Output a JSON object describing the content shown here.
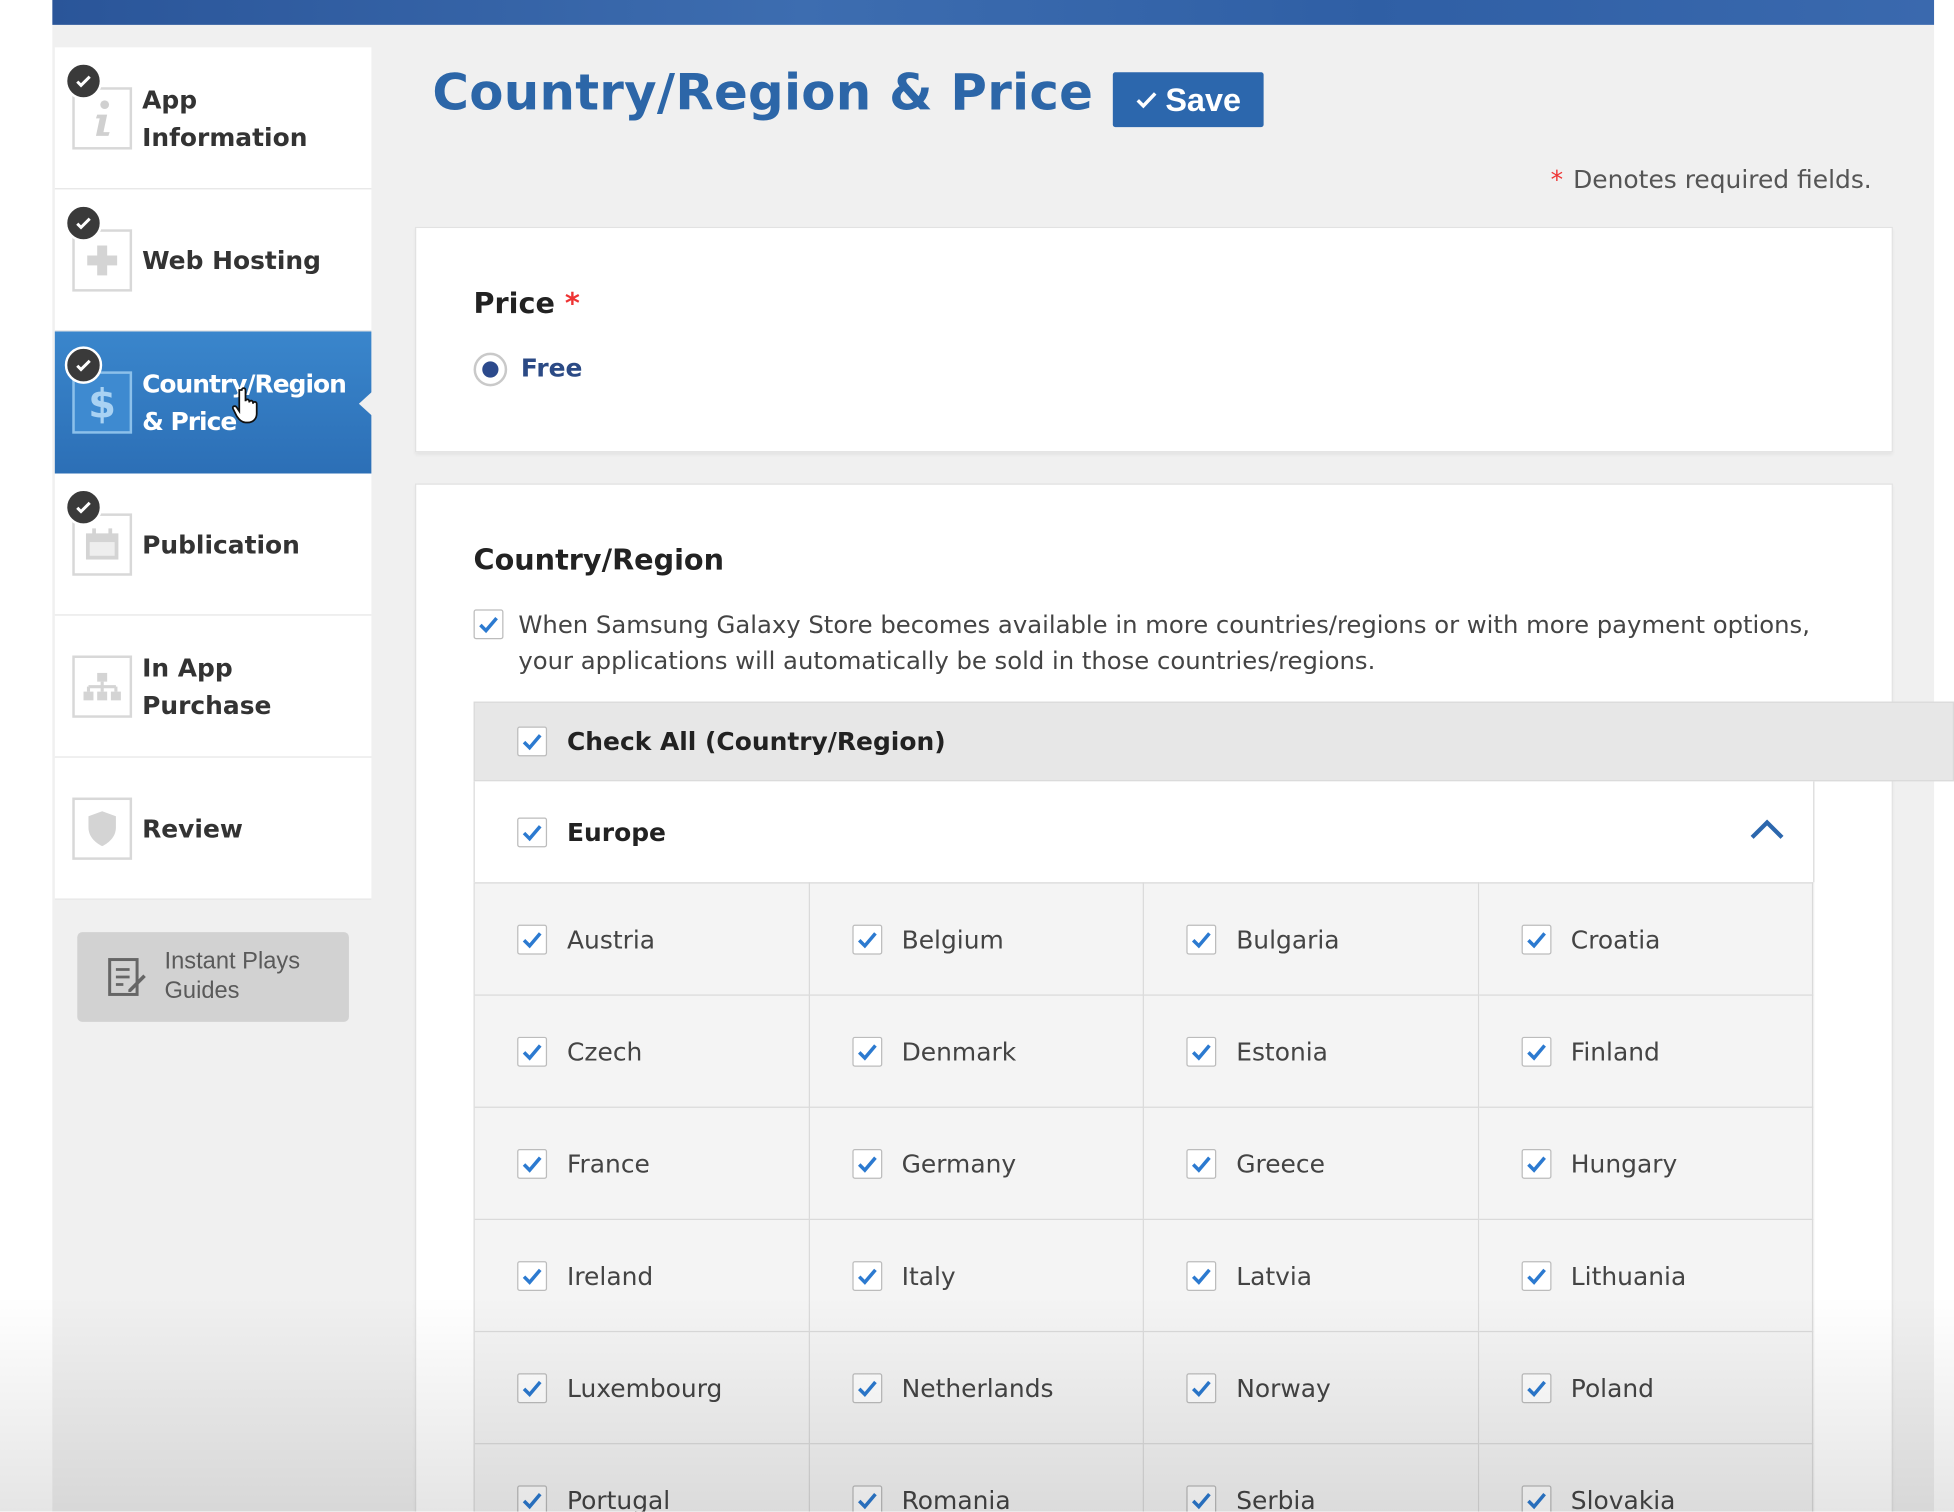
{
  "colors": {
    "brand_blue": "#2c66a8",
    "active_nav": "#2f76bd",
    "checkbox_blue": "#2c7ad0",
    "required_star": "#e33333"
  },
  "sidebar": {
    "items": [
      {
        "label": "App Information",
        "icon": "info-icon",
        "completed": true,
        "active": false
      },
      {
        "label": "Web Hosting",
        "icon": "plus-icon",
        "completed": true,
        "active": false
      },
      {
        "label": "Country/Region & Price",
        "icon": "dollar-icon",
        "completed": true,
        "active": true
      },
      {
        "label": "Publication",
        "icon": "calendar-icon",
        "completed": true,
        "active": false
      },
      {
        "label": "In App Purchase",
        "icon": "hierarchy-icon",
        "completed": false,
        "active": false
      },
      {
        "label": "Review",
        "icon": "shield-icon",
        "completed": false,
        "active": false
      }
    ],
    "guides_button": {
      "label": "Instant Plays Guides",
      "icon": "edit-document-icon"
    }
  },
  "header": {
    "title": "Country/Region & Price",
    "save_label": "Save",
    "required_note": "Denotes required fields.",
    "required_star": "*"
  },
  "price": {
    "title": "Price",
    "required_star": "*",
    "option_label": "Free",
    "selected": true
  },
  "region": {
    "title": "Country/Region",
    "auto_sell_text": "When Samsung Galaxy Store becomes available in more countries/regions or with more payment options, your applications will automatically be sold in those countries/regions.",
    "auto_sell_checked": true,
    "check_all_label": "Check All (Country/Region)",
    "check_all_checked": true,
    "group_label": "Europe",
    "group_checked": true,
    "group_expanded": true,
    "countries": [
      "Austria",
      "Belgium",
      "Bulgaria",
      "Croatia",
      "Czech",
      "Denmark",
      "Estonia",
      "Finland",
      "France",
      "Germany",
      "Greece",
      "Hungary",
      "Ireland",
      "Italy",
      "Latvia",
      "Lithuania",
      "Luxembourg",
      "Netherlands",
      "Norway",
      "Poland",
      "Portugal",
      "Romania",
      "Serbia",
      "Slovakia"
    ]
  }
}
